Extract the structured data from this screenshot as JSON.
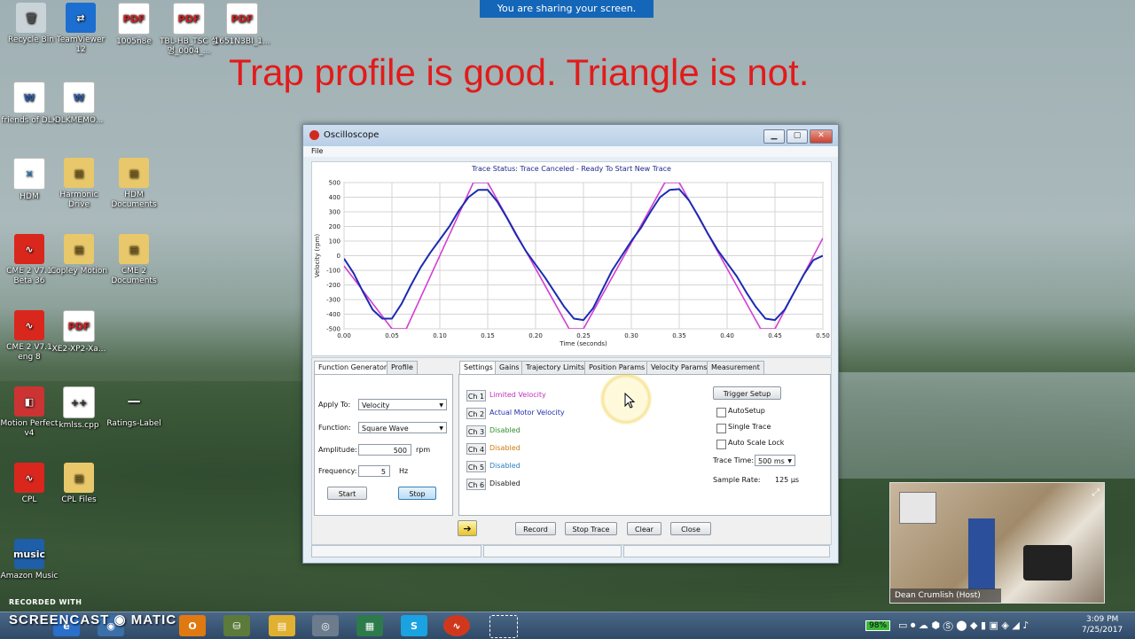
{
  "banner": "You are sharing your screen.",
  "headline": "Trap profile is good. Triangle is not.",
  "desktop_icons": [
    {
      "label": "Recycle Bin",
      "glyph": "🗑"
    },
    {
      "label": "TeamViewer 12",
      "glyph": "⇄"
    },
    {
      "label": "1005n8e",
      "glyph": "PDF"
    },
    {
      "label": "TBL-HB_TSC 설명_0004_...",
      "glyph": "PDF"
    },
    {
      "label": "1651N3BI_1...",
      "glyph": "PDF"
    },
    {
      "label": "friends of DLK",
      "glyph": "W"
    },
    {
      "label": "DLKMEMO...",
      "glyph": "W"
    },
    {
      "label": "HDM",
      "glyph": "✕"
    },
    {
      "label": "Harmonic Drive",
      "glyph": "▤"
    },
    {
      "label": "HDM Documents",
      "glyph": "▤"
    },
    {
      "label": "CME 2 V7.1 Beta 36",
      "glyph": "∿"
    },
    {
      "label": "Copley Motion",
      "glyph": "▤"
    },
    {
      "label": "CME 2 Documents",
      "glyph": "▤"
    },
    {
      "label": "CME 2 V7.1 eng 8",
      "glyph": "∿"
    },
    {
      "label": "XE2-XP2-Xa...",
      "glyph": "PDF"
    },
    {
      "label": "Motion Perfect v4",
      "glyph": "◧"
    },
    {
      "label": "kmlss.cpp",
      "glyph": "++"
    },
    {
      "label": "Ratings-Label",
      "glyph": "━━"
    },
    {
      "label": "CPL",
      "glyph": "∿"
    },
    {
      "label": "CPL Files",
      "glyph": "▤"
    },
    {
      "label": "Amazon Music",
      "glyph": "music"
    }
  ],
  "window": {
    "title": "Oscilloscope",
    "menu_file": "File",
    "trace_status": "Trace Status:  Trace Canceled - Ready To Start New Trace",
    "left_tabs": [
      "Function Generator",
      "Profile"
    ],
    "right_tabs": [
      "Settings",
      "Gains",
      "Trajectory Limits",
      "Position Params",
      "Velocity Params",
      "Measurement"
    ],
    "fg": {
      "apply_label": "Apply To:",
      "apply_value": "Velocity",
      "function_label": "Function:",
      "function_value": "Square Wave",
      "amplitude_label": "Amplitude:",
      "amplitude_value": "500",
      "amplitude_unit": "rpm",
      "frequency_label": "Frequency:",
      "frequency_value": "5",
      "frequency_unit": "Hz",
      "start": "Start",
      "stop": "Stop"
    },
    "channels": [
      {
        "tag": "Ch 1",
        "name": "Limited Velocity",
        "color": "#c030c0"
      },
      {
        "tag": "Ch 2",
        "name": "Actual Motor Velocity",
        "color": "#2030b0"
      },
      {
        "tag": "Ch 3",
        "name": "Disabled",
        "color": "#2f8f2f"
      },
      {
        "tag": "Ch 4",
        "name": "Disabled",
        "color": "#d07a10"
      },
      {
        "tag": "Ch 5",
        "name": "Disabled",
        "color": "#2a7fbf"
      },
      {
        "tag": "Ch 6",
        "name": "Disabled",
        "color": "#222222"
      }
    ],
    "settings": {
      "trigger_setup": "Trigger Setup",
      "autosetup": "AutoSetup",
      "single_trace": "Single Trace",
      "auto_scale_lock": "Auto Scale Lock",
      "trace_time_label": "Trace Time:",
      "trace_time_value": "500 ms",
      "sample_rate_label": "Sample Rate:",
      "sample_rate_value": "125 μs"
    },
    "bottom_buttons": [
      "Record",
      "Stop Trace",
      "Clear",
      "Close"
    ]
  },
  "chart_data": {
    "type": "line",
    "title": "",
    "xlabel": "Time (seconds)",
    "ylabel": "Velocity (rpm)",
    "xlim": [
      0,
      0.5
    ],
    "ylim": [
      -500,
      500
    ],
    "xticks": [
      "0.00",
      "0.05",
      "0.10",
      "0.15",
      "0.20",
      "0.25",
      "0.30",
      "0.35",
      "0.40",
      "0.45",
      "0.50"
    ],
    "yticks": [
      "500",
      "400",
      "300",
      "200",
      "100",
      "0",
      "-100",
      "-200",
      "-300",
      "-400",
      "-500"
    ],
    "grid": true,
    "series": [
      {
        "name": "Limited Velocity",
        "color": "#d23fd2",
        "x": [
          0,
          0.05,
          0.065,
          0.135,
          0.15,
          0.235,
          0.25,
          0.335,
          0.35,
          0.435,
          0.45,
          0.5
        ],
        "y": [
          -70,
          -500,
          -500,
          500,
          500,
          -500,
          -500,
          500,
          500,
          -500,
          -500,
          120
        ]
      },
      {
        "name": "Actual Motor Velocity",
        "color": "#1c2bb0",
        "x": [
          0,
          0.01,
          0.02,
          0.03,
          0.04,
          0.05,
          0.06,
          0.07,
          0.08,
          0.09,
          0.1,
          0.11,
          0.12,
          0.13,
          0.14,
          0.15,
          0.16,
          0.17,
          0.18,
          0.19,
          0.2,
          0.21,
          0.22,
          0.23,
          0.24,
          0.25,
          0.26,
          0.27,
          0.28,
          0.29,
          0.3,
          0.31,
          0.32,
          0.33,
          0.34,
          0.35,
          0.36,
          0.37,
          0.38,
          0.39,
          0.4,
          0.41,
          0.42,
          0.43,
          0.44,
          0.45,
          0.46,
          0.47,
          0.48,
          0.49,
          0.5
        ],
        "y": [
          -20,
          -120,
          -250,
          -370,
          -430,
          -430,
          -330,
          -200,
          -80,
          20,
          110,
          200,
          310,
          400,
          450,
          450,
          370,
          260,
          140,
          30,
          -60,
          -150,
          -250,
          -350,
          -430,
          -440,
          -360,
          -230,
          -100,
          0,
          100,
          190,
          300,
          400,
          450,
          455,
          380,
          270,
          150,
          40,
          -50,
          -140,
          -250,
          -350,
          -430,
          -440,
          -370,
          -250,
          -130,
          -30,
          0
        ]
      }
    ]
  },
  "webcam": {
    "host_label": "Dean Crumlish (Host)"
  },
  "watermark": {
    "line1": "RECORDED WITH",
    "line2": "SCREENCAST ◉ MATIC"
  },
  "tray": {
    "battery": "98%",
    "time": "3:09 PM",
    "date": "7/25/2017"
  }
}
